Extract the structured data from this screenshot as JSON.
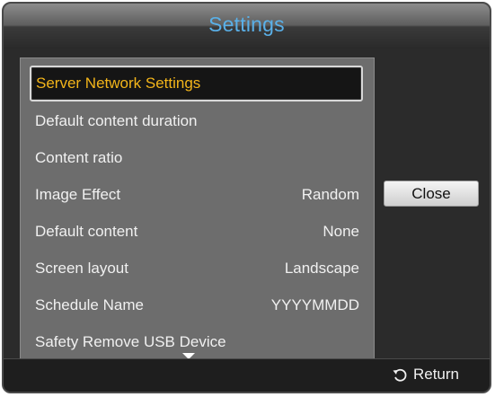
{
  "dialog": {
    "title": "Settings",
    "close_label": "Close",
    "return_label": "Return"
  },
  "menu": {
    "items": [
      {
        "label": "Server Network Settings",
        "value": ""
      },
      {
        "label": "Default content duration",
        "value": ""
      },
      {
        "label": "Content ratio",
        "value": ""
      },
      {
        "label": "Image Effect",
        "value": "Random"
      },
      {
        "label": "Default content",
        "value": "None"
      },
      {
        "label": "Screen layout",
        "value": "Landscape"
      },
      {
        "label": "Schedule Name",
        "value": "YYYYMMDD"
      },
      {
        "label": "Safety Remove USB Device",
        "value": ""
      }
    ],
    "selected_index": 0
  },
  "colors": {
    "title": "#5ab0e8",
    "selected_text": "#f3b51a",
    "panel": "#6d6d6d"
  },
  "icons": {
    "return": "return-arrow-icon",
    "scroll": "scroll-down-arrow-icon"
  }
}
